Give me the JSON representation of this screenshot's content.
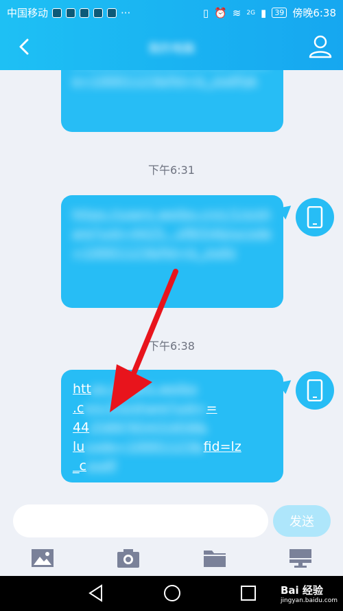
{
  "status_bar": {
    "carrier": "中国移动",
    "more": "···",
    "signal_label": "2G",
    "battery": "39",
    "time": "傍晚6:38"
  },
  "header": {
    "title": "我的电脑"
  },
  "messages": [
    {
      "type": "bubble",
      "text": "4425897654316587582 lucode=10001123&fid=lz_zsdlfgk"
    },
    {
      "type": "time",
      "text": "下午6:31"
    },
    {
      "type": "bubble",
      "text": "https://users.weibo.cn/c/1/s/share?uid=4425...sf6t54&lucode=10001123&fid=lz_zsdlz"
    },
    {
      "type": "time",
      "text": "下午6:38"
    },
    {
      "type": "bubble",
      "parts": [
        "htt",
        "ps://users.weibo",
        ".c",
        "n/c/1/s/share?uid=",
        "44",
        "2589765431658&",
        "lu",
        "code=10001123&",
        "fid=lz",
        "_c",
        "zsdlf"
      ]
    }
  ],
  "input": {
    "placeholder": "",
    "send_label": "发送"
  },
  "watermark": {
    "brand": "Bai 经验",
    "url": "jingyan.baidu.com"
  },
  "colors": {
    "accent": "#1ec0f4",
    "bubble": "#27bdf5",
    "send_disabled": "#aee6fb",
    "arrow": "#e8141c"
  }
}
